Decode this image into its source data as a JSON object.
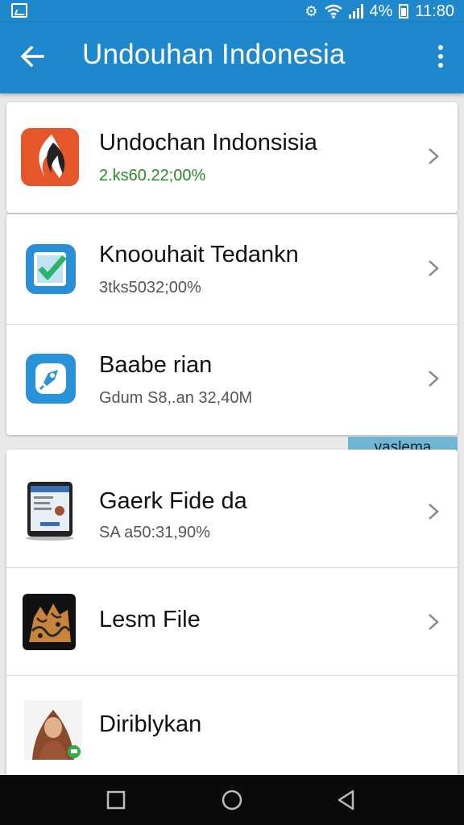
{
  "status_bar": {
    "battery_percent": "4%",
    "time": "11:80"
  },
  "app_bar": {
    "title": "Undouhan Indonesia"
  },
  "items": [
    {
      "title": "Undochan Indonsisia",
      "subtitle": "2.ks60.22;00%",
      "icon": "flame-app-icon"
    },
    {
      "title": "Knoouhait Tedankn",
      "subtitle": "3tks5032;00%",
      "icon": "check-app-icon"
    },
    {
      "title": "Baabe rian",
      "subtitle": "Gdum S8,.an 32,40M",
      "icon": "rocket-app-icon"
    },
    {
      "title": "Gaerk Fide da",
      "subtitle": "SA a50:31,90%",
      "icon": "tablet-app-icon"
    },
    {
      "title": "Lesm File",
      "subtitle": "",
      "icon": "batik-app-icon"
    },
    {
      "title": "Diriblykan",
      "subtitle": "",
      "icon": "person-avatar-icon"
    }
  ],
  "section_tag": "vaslema",
  "colors": {
    "primary": "#1f88cd",
    "accent_green": "#2a8a2a",
    "tag_bg": "#6fb6d3"
  }
}
